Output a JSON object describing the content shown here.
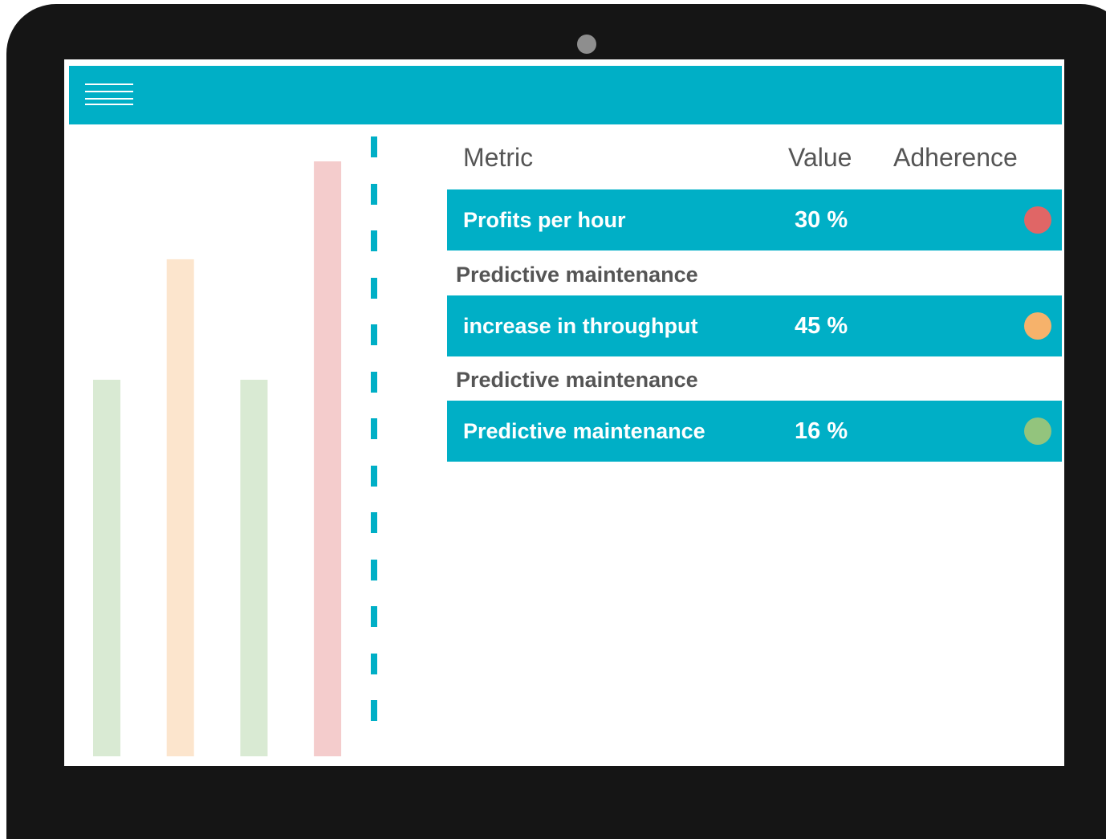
{
  "table": {
    "header": {
      "metric": "Metric",
      "value": "Value",
      "adherence": "Adherence"
    },
    "rows": [
      {
        "label": "Profits per hour",
        "value": "30 %",
        "adherence_color": "#e06666"
      },
      {
        "label": "increase in throughput",
        "value": "45 %",
        "adherence_color": "#f6b26b"
      },
      {
        "label": "Predictive maintenance",
        "value": "16 %",
        "adherence_color": "#93c47d"
      }
    ],
    "section_labels": [
      "Predictive maintenance",
      "Predictive maintenance"
    ]
  },
  "chart_data": {
    "type": "bar",
    "values": [
      0.5,
      0.66,
      0.5,
      0.79
    ],
    "colors": [
      "#d9ead3",
      "#fce5cd",
      "#d9ead3",
      "#f4cccc"
    ]
  },
  "colors": {
    "accent": "#00afc6",
    "device_frame": "#151515"
  },
  "icons": {
    "menu": "hamburger-menu-icon"
  }
}
